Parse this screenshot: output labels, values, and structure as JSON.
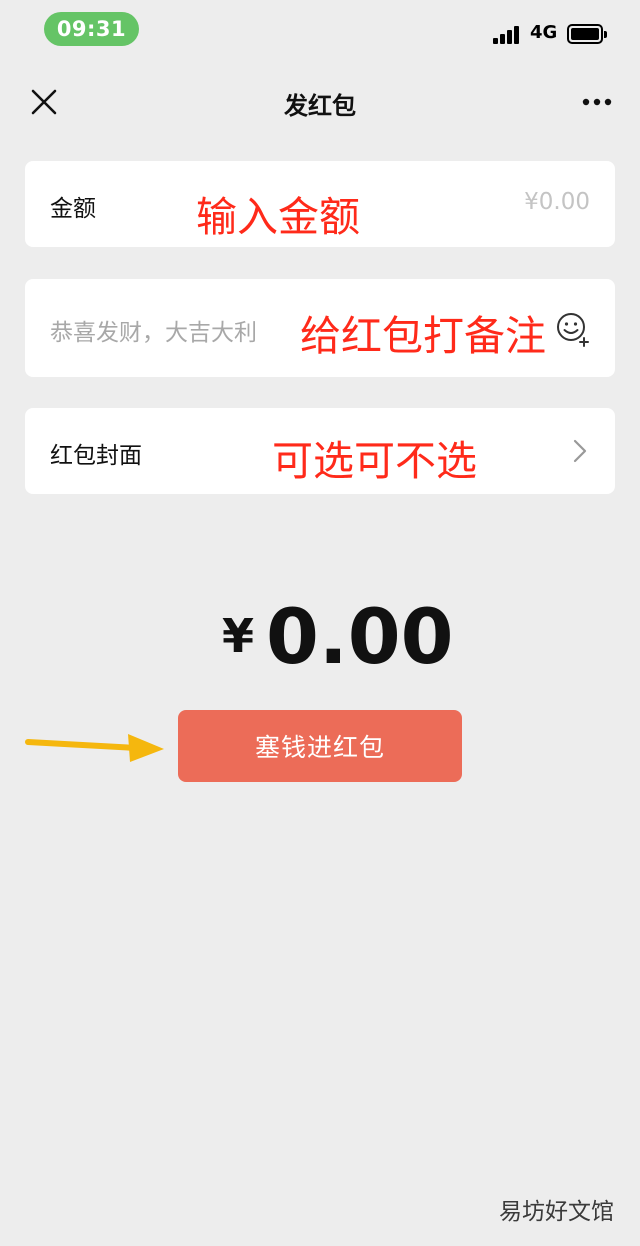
{
  "status_bar": {
    "time": "09:31",
    "network": "4G"
  },
  "nav": {
    "title": "发红包"
  },
  "amount_row": {
    "label": "金额",
    "placeholder": "¥0.00",
    "annotation": "输入金额"
  },
  "note_row": {
    "placeholder": "恭喜发财，大吉大利",
    "annotation": "给红包打备注"
  },
  "cover_row": {
    "label": "红包封面",
    "annotation": "可选可不选"
  },
  "total": {
    "currency": "¥",
    "amount": "0.00"
  },
  "submit_button": {
    "label": "塞钱进红包"
  },
  "watermark": "易坊好文馆",
  "colors": {
    "background": "#ededed",
    "button": "#ec6c58",
    "annotation": "#ff2a1a",
    "time_pill": "#65c466",
    "arrow": "#f5b70e"
  }
}
